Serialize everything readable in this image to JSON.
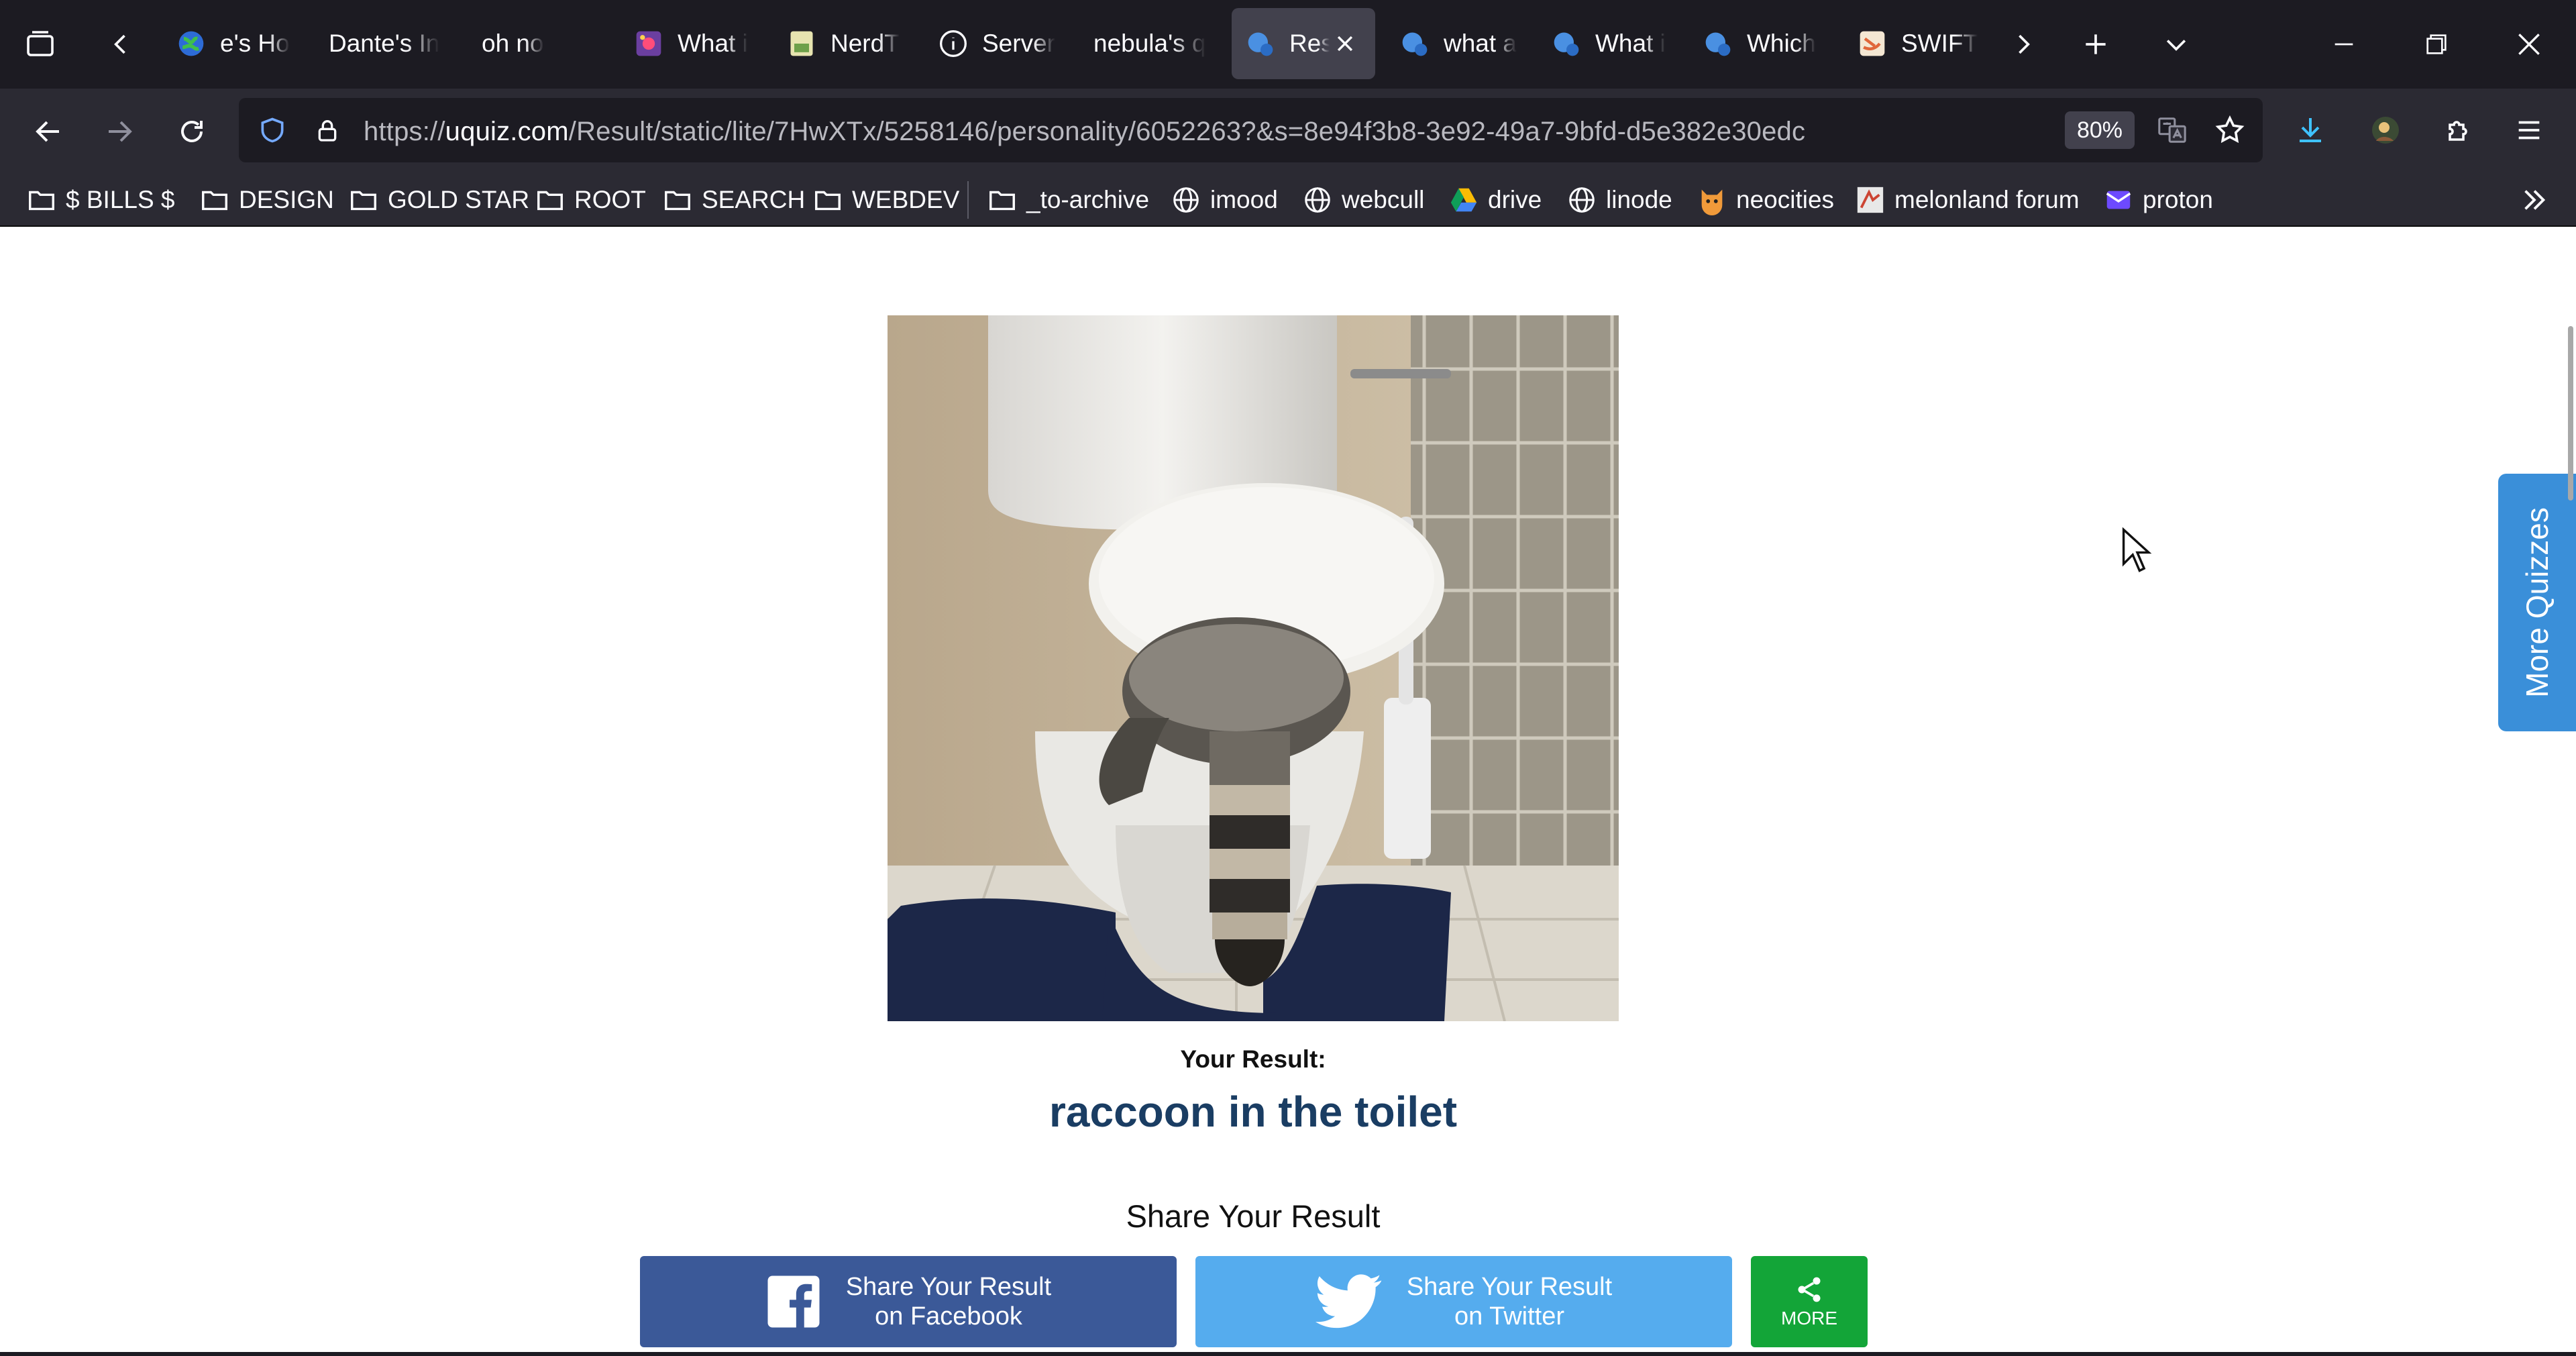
{
  "tabs": [
    {
      "title": "e's Ho",
      "icon": "globe-colorful-icon"
    },
    {
      "title": "Dante's In",
      "icon": ""
    },
    {
      "title": "oh no",
      "icon": ""
    },
    {
      "title": "What i",
      "icon": "sparkle-icon"
    },
    {
      "title": "NerdT",
      "icon": "nerdtest-icon"
    },
    {
      "title": "Server",
      "icon": "info-icon"
    },
    {
      "title": "nebula's q",
      "icon": ""
    },
    {
      "title": "Res",
      "icon": "uquiz-icon",
      "active": true
    },
    {
      "title": "what a",
      "icon": "uquiz-icon"
    },
    {
      "title": "What i",
      "icon": "uquiz-icon"
    },
    {
      "title": "Which",
      "icon": "uquiz-icon"
    },
    {
      "title": "SWIFT",
      "icon": "swift-icon"
    }
  ],
  "urlbar": {
    "prefix": "https://",
    "host": "uquiz.com",
    "path": "/Result/static/lite/7HwXTx/5258146/personality/6052263?&s=8e94f3b8-3e92-49a7-9bfd-d5e382e30edc",
    "zoom": "80%"
  },
  "bookmarks": [
    {
      "label": "$ BILLS $",
      "icon": "folder-icon"
    },
    {
      "label": "DESIGN",
      "icon": "folder-icon"
    },
    {
      "label": "GOLD STAR",
      "icon": "folder-icon"
    },
    {
      "label": "ROOT",
      "icon": "folder-icon"
    },
    {
      "label": "SEARCH",
      "icon": "folder-icon"
    },
    {
      "label": "WEBDEV",
      "icon": "folder-icon"
    },
    {
      "label": "_to-archive",
      "icon": "folder-icon"
    },
    {
      "label": "imood",
      "icon": "globe-icon"
    },
    {
      "label": "webcull",
      "icon": "globe-icon"
    },
    {
      "label": "drive",
      "icon": "drive-icon"
    },
    {
      "label": "linode",
      "icon": "globe-icon"
    },
    {
      "label": "neocities",
      "icon": "neocities-cat-icon"
    },
    {
      "label": "melonland forum",
      "icon": "melonland-icon"
    },
    {
      "label": "proton",
      "icon": "proton-mail-icon"
    }
  ],
  "result": {
    "heading": "Your Result:",
    "title": "raccoon in the toilet",
    "image_subject": "raccoon-in-toilet-photo"
  },
  "share": {
    "heading": "Share Your Result",
    "facebook_line1": "Share Your Result",
    "facebook_line2": "on Facebook",
    "twitter_line1": "Share Your Result",
    "twitter_line2": "on Twitter",
    "more_label": "MORE"
  },
  "side_tab": {
    "label": "More Quizzes"
  },
  "colors": {
    "tabbar_bg": "#1c1b22",
    "toolbar_bg": "#2b2a33",
    "result_title": "#1a3d63",
    "facebook": "#3b5998",
    "twitter": "#55acee",
    "more": "#13a538",
    "side_tab": "#3a8fd9"
  }
}
